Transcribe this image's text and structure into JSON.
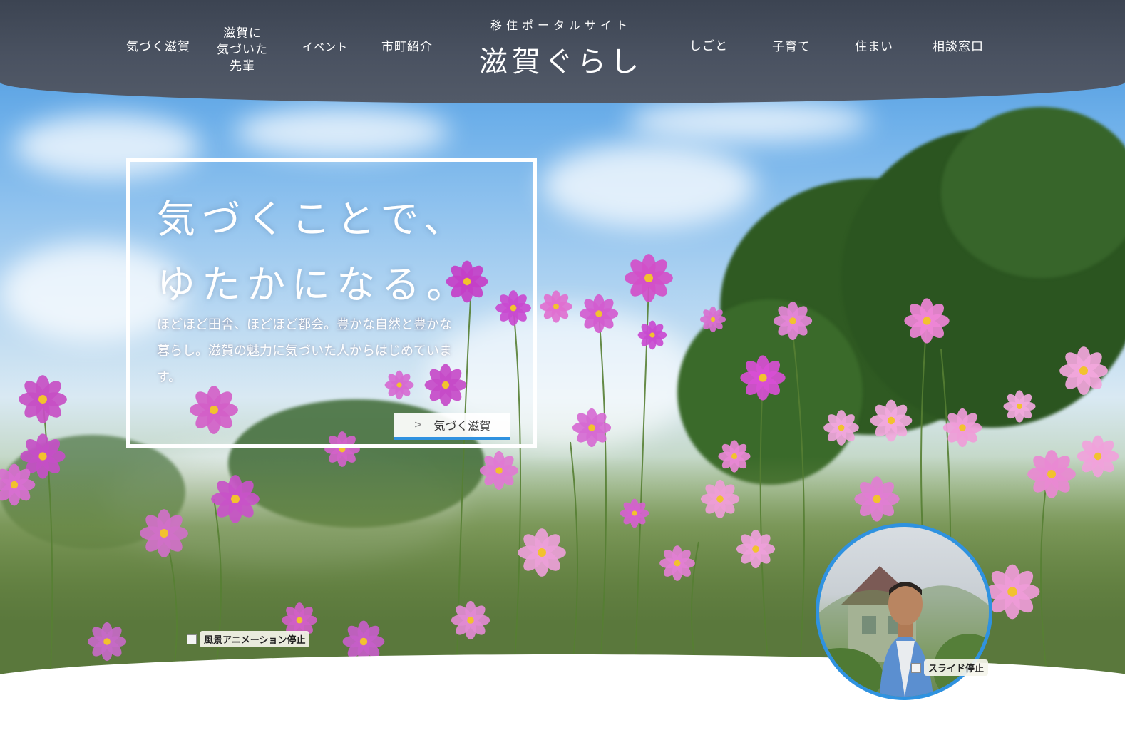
{
  "header": {
    "nav_left": [
      {
        "label": "気づく滋賀"
      },
      {
        "label_lines": [
          "滋賀に",
          "気づいた",
          "先輩"
        ]
      },
      {
        "label": "イベント"
      },
      {
        "label": "市町紹介"
      }
    ],
    "logo": {
      "subtitle": "移住ポータルサイト",
      "title": "滋賀ぐらし"
    },
    "nav_right": [
      {
        "label": "しごと"
      },
      {
        "label": "子育て"
      },
      {
        "label": "住まい"
      },
      {
        "label": "相談窓口"
      }
    ]
  },
  "hero": {
    "catch_line1": "気づくことで、",
    "catch_line2": "ゆたかになる。",
    "lead_lines": [
      "ほどほど田舎、ほどほど都会。豊かな自然と豊かな",
      "暮らし。滋賀の魅力に気づいた人からはじめていま",
      "す。"
    ],
    "button_label": "気づく滋賀",
    "button_chevron": ">"
  },
  "controls": {
    "stop_animation_label": "風景アニメーション停止",
    "stop_slide_label": "スライド停止"
  },
  "colors": {
    "header_bg": "#4a5261",
    "accent_blue": "#2f92e0",
    "text_white": "#ffffff"
  }
}
